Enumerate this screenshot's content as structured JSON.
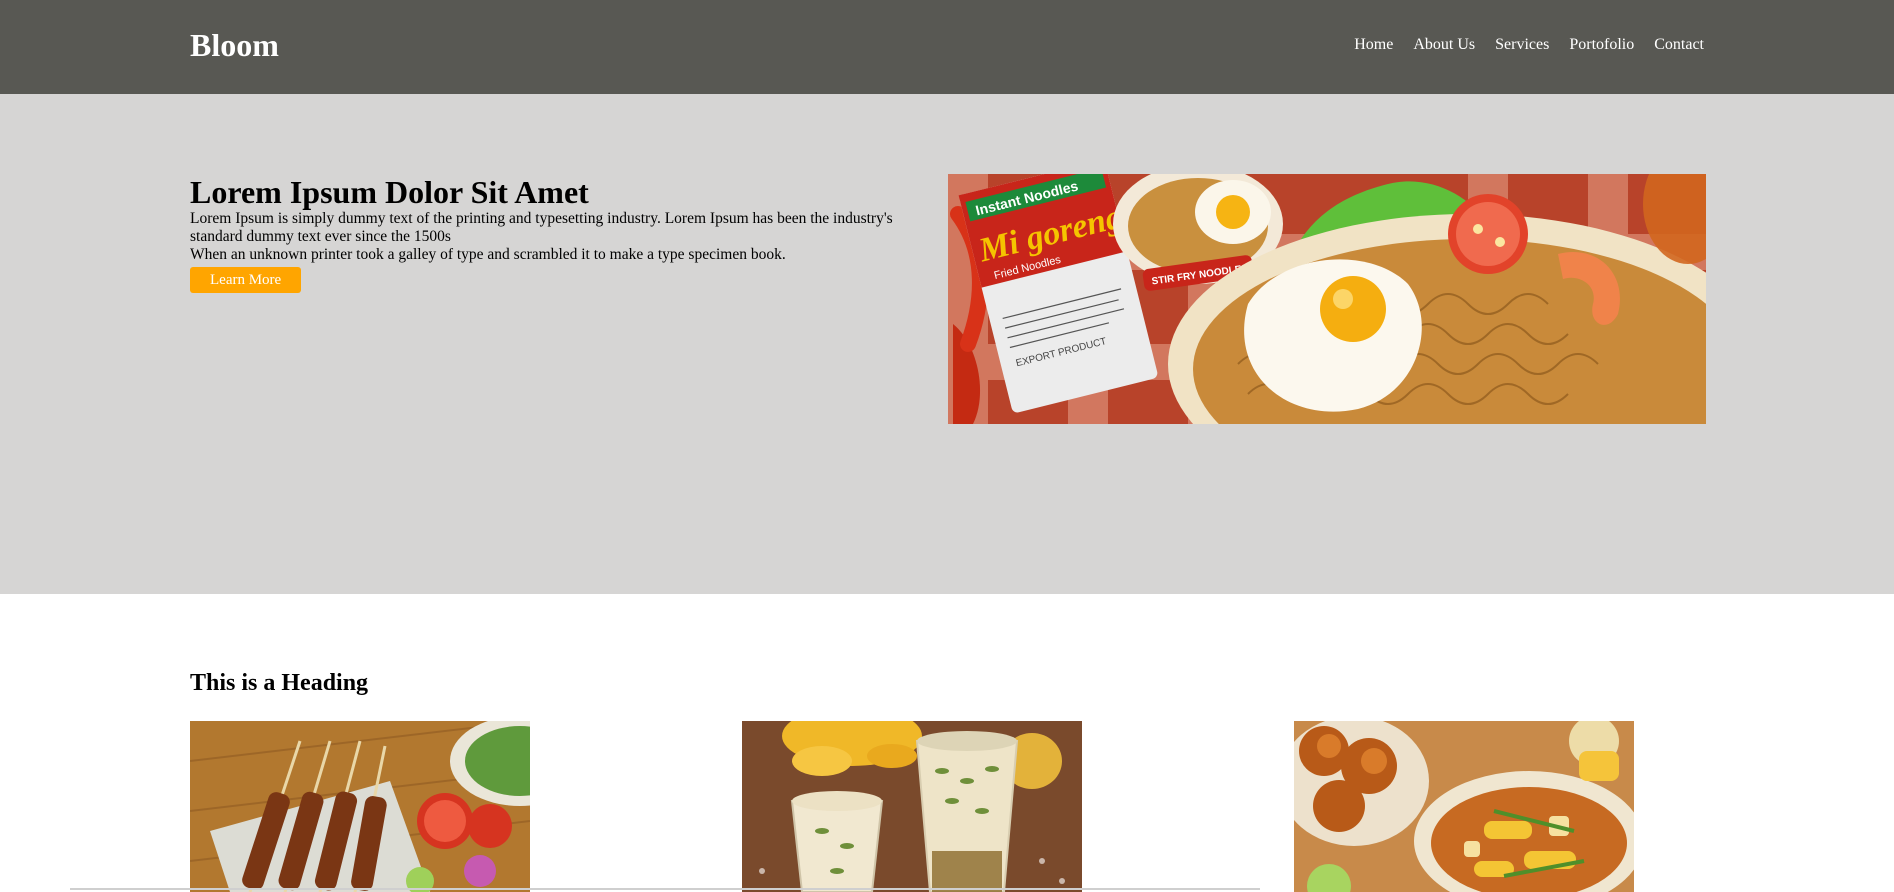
{
  "header": {
    "logo": "Bloom",
    "nav": [
      "Home",
      "About Us",
      "Services",
      "Portofolio",
      "Contact"
    ]
  },
  "hero": {
    "title": "Lorem Ipsum Dolor Sit Amet",
    "paragraph1": "Lorem Ipsum is simply dummy text of the printing and typesetting industry. Lorem Ipsum has been the industry's standard dummy text ever since the 1500s",
    "paragraph2": "When an unknown printer took a galley of type and scrambled it to make a type specimen book.",
    "button_label": "Learn More",
    "image_icon": "noodle-dish-image",
    "package_text": {
      "brand": "Instant Noodles",
      "name": "Mi goreng",
      "subtitle": "Fried Noodles",
      "tag": "STIR FRY NOODLES",
      "footer": "EXPORT PRODUCT"
    }
  },
  "section": {
    "heading": "This is a Heading",
    "cards": [
      {
        "icon": "satay-skewers-image"
      },
      {
        "icon": "drinks-image"
      },
      {
        "icon": "fried-chicken-soup-image"
      }
    ]
  },
  "colors": {
    "navbar": "#585853",
    "hero_bg": "#d6d5d4",
    "accent": "#ffa500"
  }
}
